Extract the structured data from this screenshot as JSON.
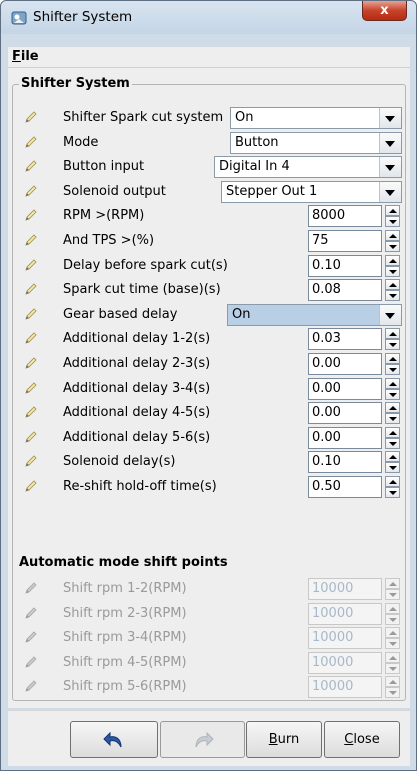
{
  "window": {
    "title": "Shifter System",
    "close_label": "x"
  },
  "menu": {
    "file_label": "File",
    "file_mnemonic": "F",
    "file_rest": "ile"
  },
  "group_title": "Shifter System",
  "rows": [
    {
      "label": "Shifter Spark cut system",
      "type": "combo",
      "value": "On"
    },
    {
      "label": "Mode",
      "type": "combo",
      "value": "Button"
    },
    {
      "label": "Button input",
      "type": "combo",
      "value": "Digital In 4"
    },
    {
      "label": "Solenoid output",
      "type": "combo",
      "value": "Stepper Out 1"
    },
    {
      "label": "RPM >(RPM)",
      "type": "spinner",
      "value": "8000"
    },
    {
      "label": "And TPS >(%)",
      "type": "spinner",
      "value": "75"
    },
    {
      "label": "Delay before spark cut(s)",
      "type": "spinner",
      "value": "0.10"
    },
    {
      "label": "Spark cut time (base)(s)",
      "type": "spinner",
      "value": "0.08"
    },
    {
      "label": "Gear based delay",
      "type": "combo",
      "value": "On"
    },
    {
      "label": "Additional delay 1-2(s)",
      "type": "spinner",
      "value": "0.03"
    },
    {
      "label": "Additional delay 2-3(s)",
      "type": "spinner",
      "value": "0.00"
    },
    {
      "label": "Additional delay 3-4(s)",
      "type": "spinner",
      "value": "0.00"
    },
    {
      "label": "Additional delay 4-5(s)",
      "type": "spinner",
      "value": "0.00"
    },
    {
      "label": "Additional delay 5-6(s)",
      "type": "spinner",
      "value": "0.00"
    },
    {
      "label": "Solenoid delay(s)",
      "type": "spinner",
      "value": "0.10"
    },
    {
      "label": "Re-shift hold-off time(s)",
      "type": "spinner",
      "value": "0.50"
    }
  ],
  "auto_section_title": "Automatic mode shift points",
  "auto_rows": [
    {
      "label": "Shift rpm 1-2(RPM)",
      "value": "10000",
      "disabled": true
    },
    {
      "label": "Shift rpm 2-3(RPM)",
      "value": "10000",
      "disabled": true
    },
    {
      "label": "Shift rpm 3-4(RPM)",
      "value": "10000",
      "disabled": true
    },
    {
      "label": "Shift rpm 4-5(RPM)",
      "value": "10000",
      "disabled": true
    },
    {
      "label": "Shift rpm 5-6(RPM)",
      "value": "10000",
      "disabled": true
    }
  ],
  "buttons": {
    "undo_icon": "undo-icon",
    "redo_icon": "redo-icon",
    "burn_label": "Burn",
    "burn_mnemonic": "B",
    "burn_rest": "urn",
    "close_label": "Close",
    "close_mnemonic": "C",
    "close_rest": "lose"
  },
  "colors": {
    "accent_blue": "#b8cfe6",
    "disabled_text": "#9a9a9a",
    "title_gradient": "#c4d5e6"
  }
}
